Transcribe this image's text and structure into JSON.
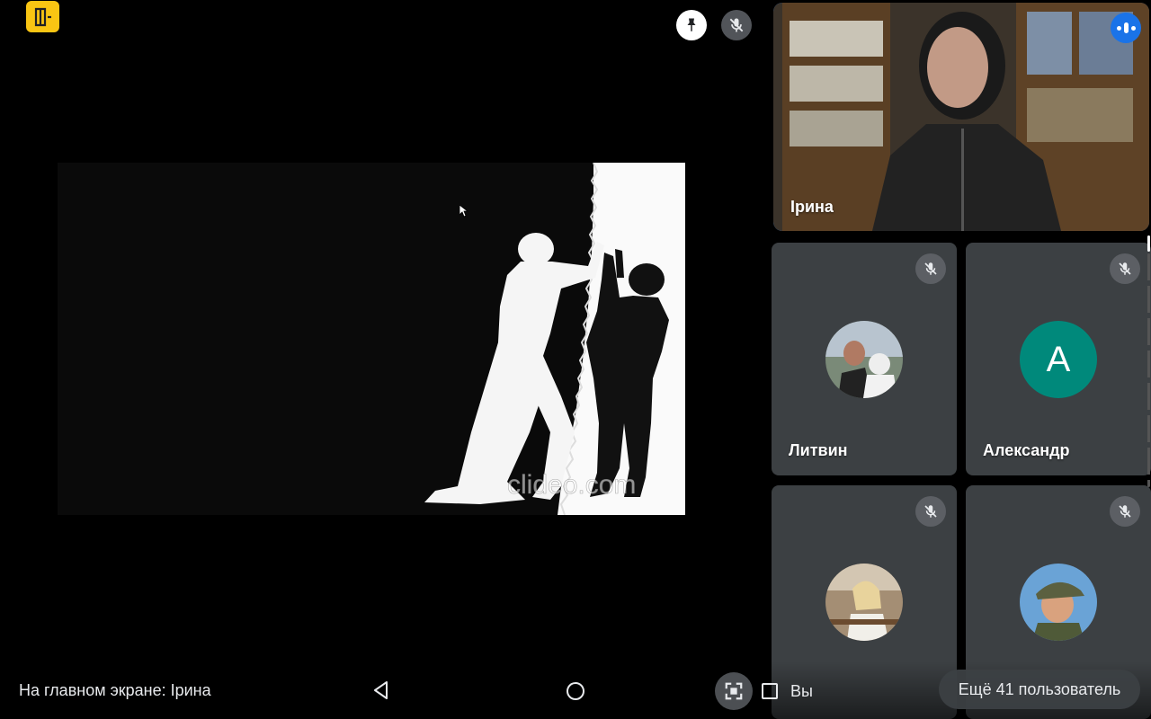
{
  "main": {
    "watermark": "clideo.com"
  },
  "participants": [
    {
      "name": "Ірина",
      "speaking": true
    },
    {
      "name": "Литвин",
      "muted": true,
      "avatar": "photo"
    },
    {
      "name": "Александр",
      "muted": true,
      "avatar_letter": "A",
      "avatar_color": "#00897b"
    },
    {
      "name": "",
      "muted": true,
      "avatar": "photo"
    },
    {
      "name": "",
      "muted": true,
      "avatar": "photo"
    }
  ],
  "bottom": {
    "status": "На главном экране: Ірина",
    "you_label": "Вы",
    "more_users": "Ещё 41 пользователь"
  },
  "colors": {
    "accent": "#1a73e8",
    "badge": "#f9c513",
    "tile_bg": "#3c4043"
  }
}
